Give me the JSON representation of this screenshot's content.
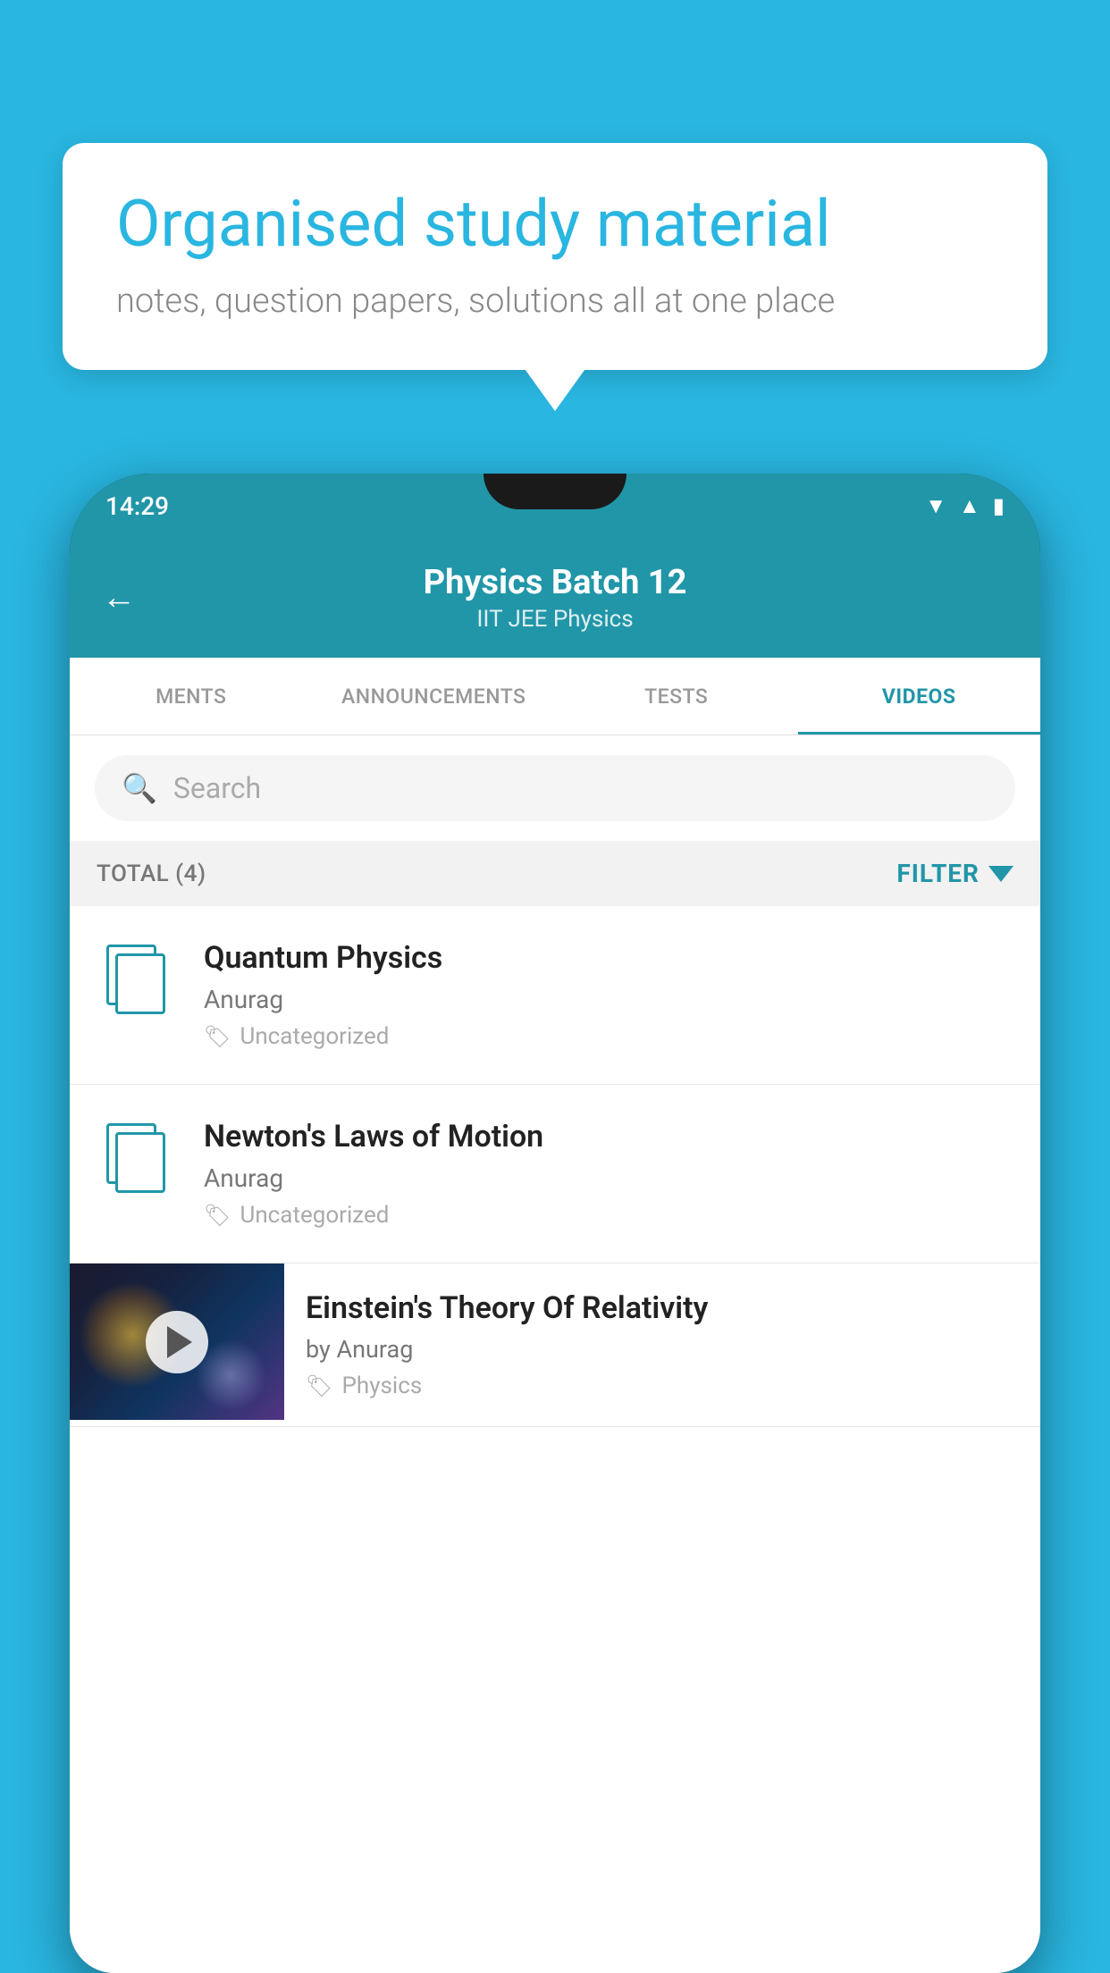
{
  "background_color": "#29b6e0",
  "speech_bubble": {
    "heading": "Organised study material",
    "subtext": "notes, question papers, solutions all at one place"
  },
  "phone": {
    "status_bar": {
      "time": "14:29"
    },
    "header": {
      "title": "Physics Batch 12",
      "subtitle": "IIT JEE   Physics",
      "back_label": "←"
    },
    "tabs": [
      {
        "label": "MENTS",
        "active": false
      },
      {
        "label": "ANNOUNCEMENTS",
        "active": false
      },
      {
        "label": "TESTS",
        "active": false
      },
      {
        "label": "VIDEOS",
        "active": true
      }
    ],
    "search": {
      "placeholder": "Search"
    },
    "filter_bar": {
      "total_label": "TOTAL (4)",
      "filter_label": "FILTER"
    },
    "videos": [
      {
        "id": 1,
        "title": "Quantum Physics",
        "author": "Anurag",
        "tag": "Uncategorized",
        "type": "document"
      },
      {
        "id": 2,
        "title": "Newton's Laws of Motion",
        "author": "Anurag",
        "tag": "Uncategorized",
        "type": "document"
      },
      {
        "id": 3,
        "title": "Einstein's Theory Of Relativity",
        "author": "by Anurag",
        "tag": "Physics",
        "type": "video"
      }
    ]
  }
}
